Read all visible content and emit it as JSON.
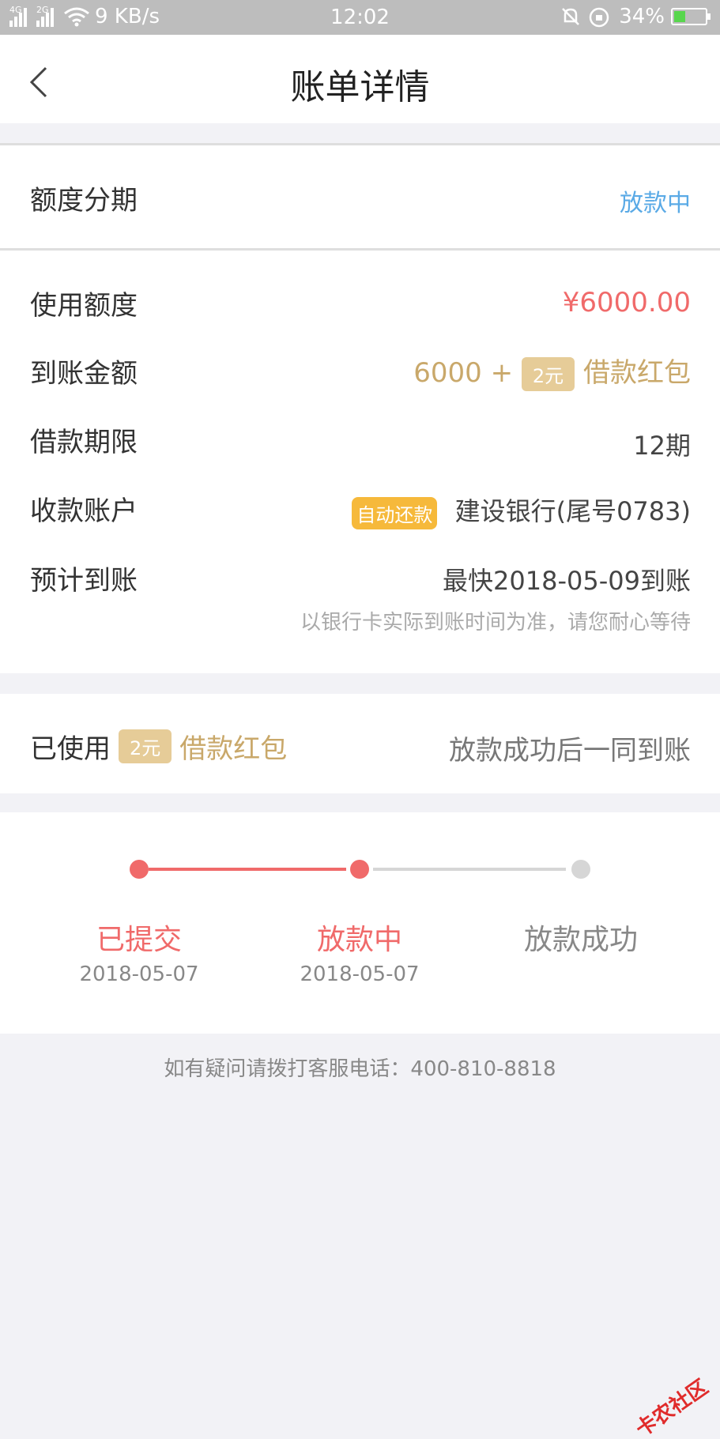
{
  "status_bar": {
    "net_type_1": "4G",
    "net_type_2": "2G",
    "speed": "9 KB/s",
    "time": "12:02",
    "battery": "34%"
  },
  "header": {
    "title": "账单详情"
  },
  "bill_type": {
    "label": "额度分期",
    "status": "放款中"
  },
  "details": {
    "used_credit": {
      "label": "使用额度",
      "value": "¥6000.00"
    },
    "arrival_amount": {
      "label": "到账金额",
      "amount": "6000 +",
      "coupon": "2元",
      "coupon_name": "借款红包"
    },
    "term": {
      "label": "借款期限",
      "value": "12期"
    },
    "account": {
      "label": "收款账户",
      "auto_badge": "自动还款",
      "value": "建设银行(尾号0783)"
    },
    "expected": {
      "label": "预计到账",
      "value": "最快2018-05-09到账",
      "note": "以银行卡实际到账时间为准，请您耐心等待"
    }
  },
  "coupon_section": {
    "label": "已使用",
    "coupon": "2元",
    "coupon_name": "借款红包",
    "note": "放款成功后一同到账"
  },
  "progress": {
    "steps": [
      {
        "label": "已提交",
        "date": "2018-05-07"
      },
      {
        "label": "放款中",
        "date": "2018-05-07"
      },
      {
        "label": "放款成功",
        "date": ""
      }
    ],
    "completed_steps": 2
  },
  "footer": {
    "note": "如有疑问请拨打客服电话：400-810-8818"
  },
  "watermark": "卡农社区",
  "colors": {
    "accent_red": "#f06a6a",
    "blue_status": "#5aaae6",
    "gold": "#c9a86a",
    "inactive": "#d6d6d6"
  }
}
